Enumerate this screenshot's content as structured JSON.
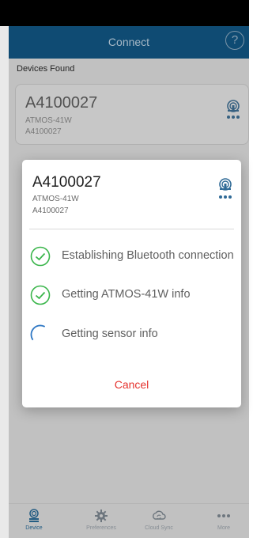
{
  "header": {
    "title": "Connect",
    "help_label": "?"
  },
  "section": {
    "devices_found_label": "Devices Found"
  },
  "device_card": {
    "name": "A4100027",
    "model": "ATMOS-41W",
    "serial": "A4100027",
    "icon": "sensor-icon"
  },
  "dialog": {
    "name": "A4100027",
    "model": "ATMOS-41W",
    "serial": "A4100027",
    "icon": "sensor-icon",
    "steps": [
      {
        "label": "Establishing Bluetooth connection",
        "state": "done"
      },
      {
        "label": "Getting ATMOS-41W info",
        "state": "done"
      },
      {
        "label": "Getting sensor info",
        "state": "in-progress"
      }
    ],
    "cancel_label": "Cancel"
  },
  "nav": {
    "items": [
      {
        "label": "Device",
        "icon": "device-icon",
        "active": true
      },
      {
        "label": "Preferences",
        "icon": "gear-icon",
        "active": false
      },
      {
        "label": "Cloud Sync",
        "icon": "cloud-sync-icon",
        "active": false
      },
      {
        "label": "More",
        "icon": "more-icon",
        "active": false
      }
    ]
  },
  "colors": {
    "header_bg": "#0f4b73",
    "accent": "#2a6a96",
    "success": "#39b54a",
    "progress": "#2f78c4",
    "cancel": "#e5322d"
  }
}
